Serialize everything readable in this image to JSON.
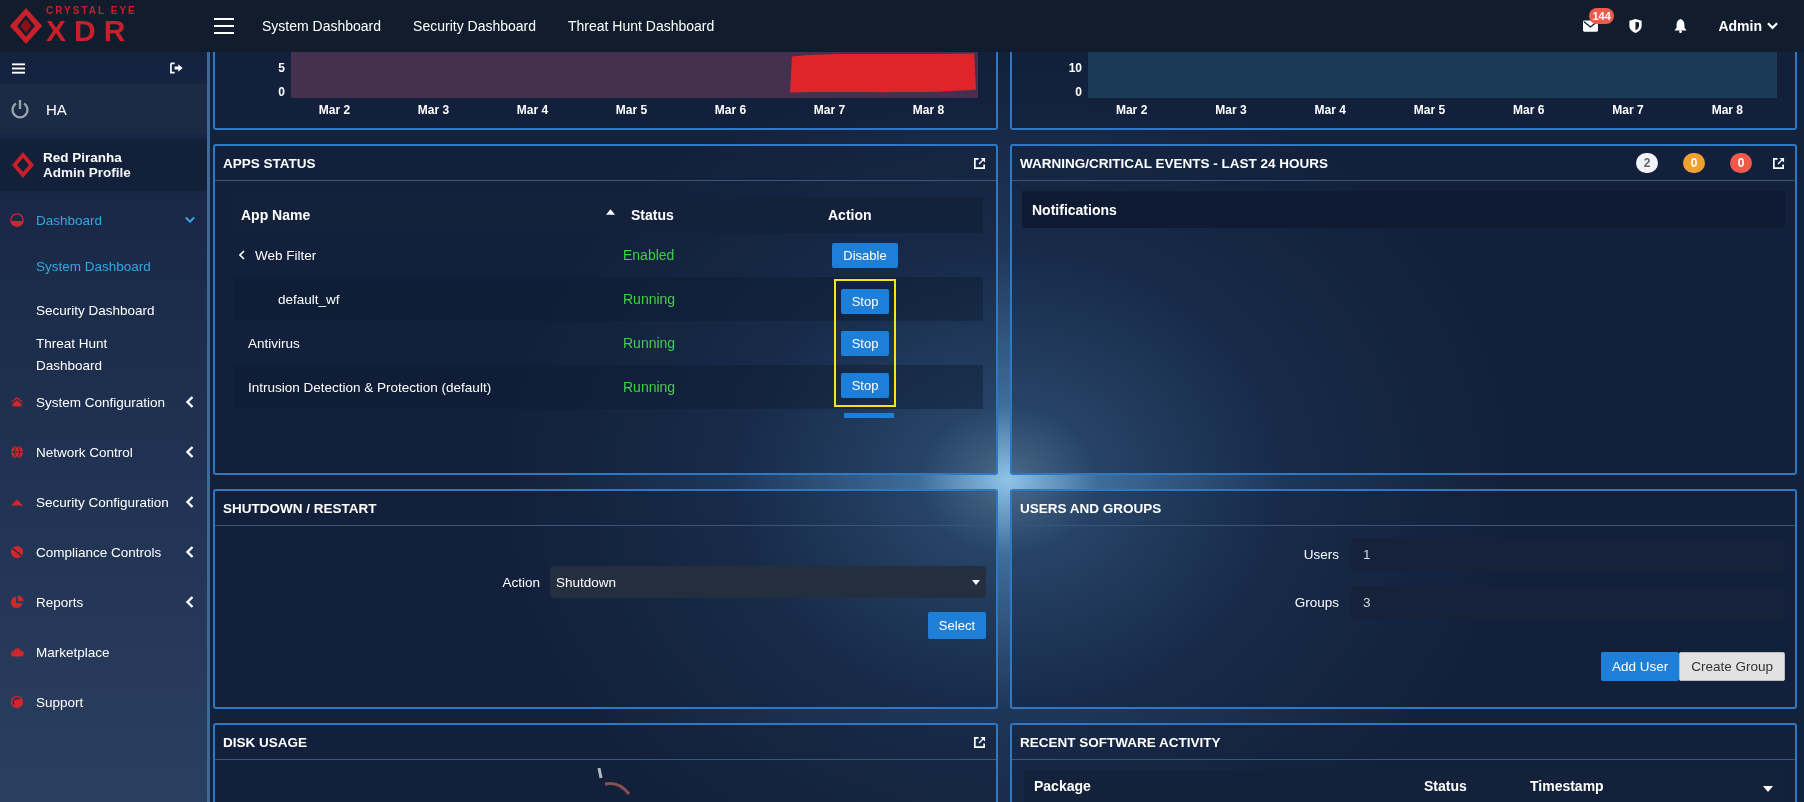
{
  "topbar": {
    "logo": {
      "tagline": "CRYSTAL EYE",
      "wordmark": "XDR"
    },
    "nav": [
      "System Dashboard",
      "Security Dashboard",
      "Threat Hunt Dashboard"
    ],
    "mail_count": "144",
    "user": "Admin"
  },
  "sidebar": {
    "ha_label": "HA",
    "profile": {
      "name": "Red Piranha",
      "role": "Admin Profile"
    },
    "items": [
      {
        "label": "Dashboard",
        "kind": "gauge",
        "selected": true,
        "expanded": true,
        "children": [
          {
            "label": "System Dashboard",
            "selected": true
          },
          {
            "label": "Security Dashboard",
            "selected": false
          },
          {
            "label": "Threat Hunt Dashboard",
            "selected": false
          }
        ]
      },
      {
        "label": "System Configuration",
        "kind": "home",
        "selected": false,
        "expanded": false
      },
      {
        "label": "Network Control",
        "kind": "globe",
        "selected": false,
        "expanded": false
      },
      {
        "label": "Security Configuration",
        "kind": "warning",
        "selected": false,
        "expanded": false
      },
      {
        "label": "Compliance Controls",
        "kind": "ban",
        "selected": false,
        "expanded": false
      },
      {
        "label": "Reports",
        "kind": "pie",
        "selected": false,
        "expanded": false
      },
      {
        "label": "Marketplace",
        "kind": "cloud",
        "selected": false
      },
      {
        "label": "Support",
        "kind": "support",
        "selected": false
      }
    ]
  },
  "top_charts": [
    {
      "color": "#45304f",
      "redacted": true,
      "y_labels": [
        "5",
        "0"
      ],
      "x_labels": [
        "Mar 2",
        "Mar 3",
        "Mar 4",
        "Mar 5",
        "Mar 6",
        "Mar 7",
        "Mar 8"
      ]
    },
    {
      "color": "#1a3a55",
      "redacted": false,
      "y_labels": [
        "10",
        "0"
      ],
      "x_labels": [
        "Mar 2",
        "Mar 3",
        "Mar 4",
        "Mar 5",
        "Mar 6",
        "Mar 7",
        "Mar 8"
      ]
    }
  ],
  "apps_status": {
    "title": "APPS STATUS",
    "columns": [
      "App Name",
      "Status",
      "Action"
    ],
    "more_below": true,
    "rows": [
      {
        "kind": "group",
        "name": "Web Filter",
        "status": "Enabled",
        "action": "Disable",
        "highlighted": false
      },
      {
        "kind": "child",
        "name": "default_wf",
        "status": "Running",
        "action": "Stop",
        "highlighted": true
      },
      {
        "kind": "app",
        "name": "Antivirus",
        "status": "Running",
        "action": "Stop",
        "highlighted": true
      },
      {
        "kind": "app",
        "name": "Intrusion Detection & Protection (default)",
        "status": "Running",
        "action": "Stop",
        "highlighted": true
      }
    ]
  },
  "warning_events": {
    "title": "WARNING/CRITICAL EVENTS - LAST 24 HOURS",
    "counts": [
      {
        "value": "2",
        "color": "#f2f4f7"
      },
      {
        "value": "0",
        "color": "#f0a030"
      },
      {
        "value": "0",
        "color": "#ef5a4a"
      }
    ],
    "list_header": "Notifications"
  },
  "shutdown_restart": {
    "title": "SHUTDOWN / RESTART",
    "label": "Action",
    "value": "Shutdown",
    "button": "Select"
  },
  "users_groups": {
    "title": "USERS AND GROUPS",
    "fields": [
      {
        "label": "Users",
        "value": "1"
      },
      {
        "label": "Groups",
        "value": "3"
      }
    ],
    "buttons": [
      {
        "label": "Add User",
        "kind": "primary"
      },
      {
        "label": "Create Group",
        "kind": "secondary"
      }
    ]
  },
  "disk_usage": {
    "title": "DISK USAGE"
  },
  "recent_software_activity": {
    "title": "RECENT SOFTWARE ACTIVITY",
    "columns": [
      "Package",
      "Status",
      "Timestamp"
    ]
  }
}
